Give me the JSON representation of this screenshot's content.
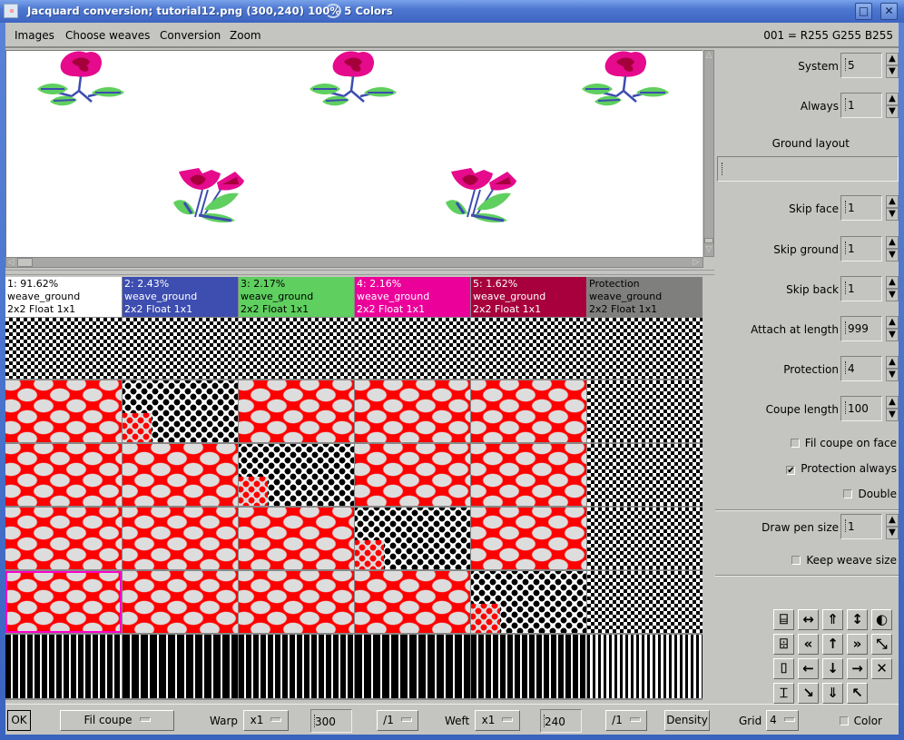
{
  "window": {
    "title": "Jacquard conversion; tutorial12.png (300,240) 100% 5 Colors",
    "maximize_icon": "maximize-icon",
    "close_icon": "close-icon"
  },
  "menu": {
    "items": [
      "Images",
      "Choose weaves",
      "Conversion",
      "Zoom"
    ],
    "pixel_info": "001 = R255 G255 B255"
  },
  "columns": [
    {
      "pct": "1: 91.62%",
      "weave": "weave_ground",
      "desc": "2x2 Float 1x1",
      "bg": "#ffffff",
      "fg": "#000000"
    },
    {
      "pct": "2: 2.43%",
      "weave": "weave_ground",
      "desc": "2x2 Float 1x1",
      "bg": "#3d4db0",
      "fg": "#ffffff"
    },
    {
      "pct": "3: 2.17%",
      "weave": "weave_ground",
      "desc": "2x2 Float 1x1",
      "bg": "#5fcf5f",
      "fg": "#000000"
    },
    {
      "pct": "4: 2.16%",
      "weave": "weave_ground",
      "desc": "2x2 Float 1x1",
      "bg": "#ec009a",
      "fg": "#ffffff"
    },
    {
      "pct": "5: 1.62%",
      "weave": "weave_ground",
      "desc": "2x2 Float 1x1",
      "bg": "#a8003c",
      "fg": "#ffffff"
    },
    {
      "pct": "Protection",
      "weave": "weave_ground",
      "desc": "2x2 Float 1x1",
      "bg": "#7f807d",
      "fg": "#000000"
    }
  ],
  "settings": {
    "system": {
      "label": "System",
      "value": "5"
    },
    "always": {
      "label": "Always",
      "value": "1"
    },
    "ground_layout": {
      "label": "Ground layout",
      "value": ""
    },
    "skip_face": {
      "label": "Skip face",
      "value": "1"
    },
    "skip_ground": {
      "label": "Skip ground",
      "value": "1"
    },
    "skip_back": {
      "label": "Skip back",
      "value": "1"
    },
    "attach_at_length": {
      "label": "Attach at length",
      "value": "999"
    },
    "protection": {
      "label": "Protection",
      "value": "4"
    },
    "coupe_length": {
      "label": "Coupe length",
      "value": "100"
    },
    "fil_coupe_on_face": {
      "label": "Fil coupe on face",
      "checked": false
    },
    "protection_always": {
      "label": "Protection always",
      "checked": true
    },
    "double": {
      "label": "Double",
      "checked": false
    },
    "draw_pen_size": {
      "label": "Draw pen size",
      "value": "1"
    },
    "keep_weave_size": {
      "label": "Keep weave size",
      "checked": false
    }
  },
  "tools": [
    {
      "name": "step-up-icon",
      "glyph": "⌸"
    },
    {
      "name": "expand-horizontal-icon",
      "glyph": "↔"
    },
    {
      "name": "double-chevron-up-icon",
      "glyph": "⇑"
    },
    {
      "name": "expand-vertical-icon",
      "glyph": "↕"
    },
    {
      "name": "invert-icon",
      "glyph": "◐"
    },
    {
      "name": "step-down-icon",
      "glyph": "⌹"
    },
    {
      "name": "double-chevron-left-icon",
      "glyph": "«"
    },
    {
      "name": "arrow-up-icon",
      "glyph": "↑"
    },
    {
      "name": "double-chevron-right-icon",
      "glyph": "»"
    },
    {
      "name": "diagonal-expand-icon",
      "glyph": "⤡"
    },
    {
      "name": "step-right-up-icon",
      "glyph": "⌷"
    },
    {
      "name": "arrow-left-icon",
      "glyph": "←"
    },
    {
      "name": "arrow-down-icon",
      "glyph": "↓"
    },
    {
      "name": "arrow-right-icon",
      "glyph": "→"
    },
    {
      "name": "clear-icon",
      "glyph": "✕"
    },
    {
      "name": "step-right-down-icon",
      "glyph": "⌶"
    },
    {
      "name": "move-down-right-icon",
      "glyph": "↘"
    },
    {
      "name": "double-chevron-down-icon",
      "glyph": "⇓"
    },
    {
      "name": "move-up-left-icon",
      "glyph": "↖"
    }
  ],
  "bottom": {
    "ok": "OK",
    "mode": "Fil coupe",
    "warp_label": "Warp",
    "warp_mult": "x1",
    "warp_value": "300",
    "warp_div": "/1",
    "weft_label": "Weft",
    "weft_mult": "x1",
    "weft_value": "240",
    "weft_div": "/1",
    "density": "Density",
    "grid_label": "Grid",
    "grid_value": "4",
    "color_label": "Color",
    "color_checked": false
  }
}
